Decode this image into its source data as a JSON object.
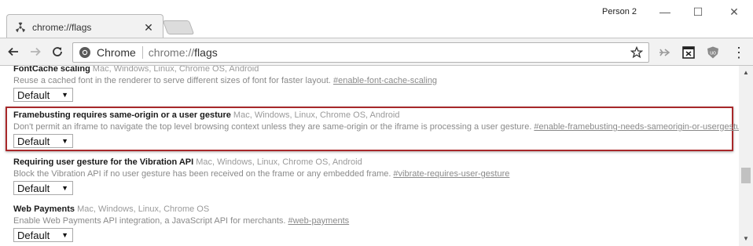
{
  "window": {
    "profile_name": "Person 2",
    "minimize_glyph": "—",
    "maximize_glyph": "☐",
    "close_glyph": "✕"
  },
  "tab": {
    "title": "chrome://flags",
    "close_glyph": "✕",
    "favicon": "flags-favicon-icon"
  },
  "toolbar": {
    "back_icon": "arrow-left-icon",
    "forward_icon": "arrow-right-icon",
    "reload_icon": "reload-icon",
    "chip_label": "Chrome",
    "url_scheme": "chrome://",
    "url_host": "flags",
    "star_icon": "star-outline-icon",
    "menu_glyph": "⋮",
    "extensions": [
      "extension-arrow-icon",
      "extension-box-icon",
      "extension-shield-icon"
    ]
  },
  "flags": [
    {
      "name": "FontCache scaling",
      "platforms": "Mac, Windows, Linux, Chrome OS, Android",
      "description": "Reuse a cached font in the renderer to serve different sizes of font for faster layout.",
      "anchor": "#enable-font-cache-scaling",
      "value": "Default"
    },
    {
      "name": "Framebusting requires same-origin or a user gesture",
      "platforms": "Mac, Windows, Linux, Chrome OS, Android",
      "description": "Don't permit an iframe to navigate the top level browsing context unless they are same-origin or the iframe is processing a user gesture.",
      "anchor": "#enable-framebusting-needs-sameorigin-or-usergesture",
      "value": "Default",
      "highlighted": true
    },
    {
      "name": "Requiring user gesture for the Vibration API",
      "platforms": "Mac, Windows, Linux, Chrome OS, Android",
      "description": "Block the Vibration API if no user gesture has been received on the frame or any embedded frame.",
      "anchor": "#vibrate-requires-user-gesture",
      "value": "Default"
    },
    {
      "name": "Web Payments",
      "platforms": "Mac, Windows, Linux, Chrome OS",
      "description": "Enable Web Payments API integration, a JavaScript API for merchants.",
      "anchor": "#web-payments",
      "value": "Default"
    }
  ],
  "select_arrow": "▼",
  "scrollbar": {
    "up_glyph": "▲",
    "down_glyph": "▼"
  },
  "colors": {
    "highlight_border": "#a8282a",
    "toolbar_bg": "#f2f2f2"
  }
}
